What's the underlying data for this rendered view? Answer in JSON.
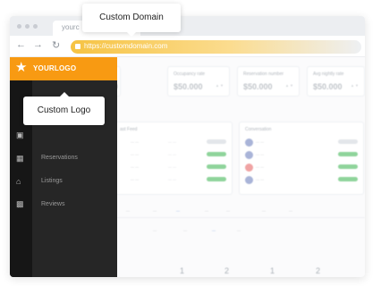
{
  "browser": {
    "tab_title": "yourc",
    "url": "https://customdomain.com",
    "icons": {
      "back": "arrow-left-icon",
      "forward": "arrow-right-icon",
      "reload": "reload-icon",
      "lock": "lock-icon"
    }
  },
  "sidebar": {
    "logo_text": "YOURLOGO",
    "logo_icon": "star-icon",
    "accent_color": "#f89a12",
    "items": [
      {
        "label": "Reservations",
        "icon": "calendar-icon"
      },
      {
        "label": "Listings",
        "icon": "home-icon"
      },
      {
        "label": "Reviews",
        "icon": "bar-chart-icon"
      }
    ]
  },
  "dashboard": {
    "cards": [
      {
        "label": "Occupancy rate",
        "value": "$50.000"
      },
      {
        "label": "Reservation number",
        "value": "$50.000"
      },
      {
        "label": "Avg nightly rate",
        "value": "$50.000"
      }
    ],
    "partial_value": "00",
    "panels": {
      "left_title": "ast Feed",
      "right_title": "Conversation"
    },
    "stats": [
      "1",
      "2",
      "1",
      "2"
    ]
  },
  "tooltips": {
    "domain": "Custom Domain",
    "logo": "Custom Logo"
  }
}
